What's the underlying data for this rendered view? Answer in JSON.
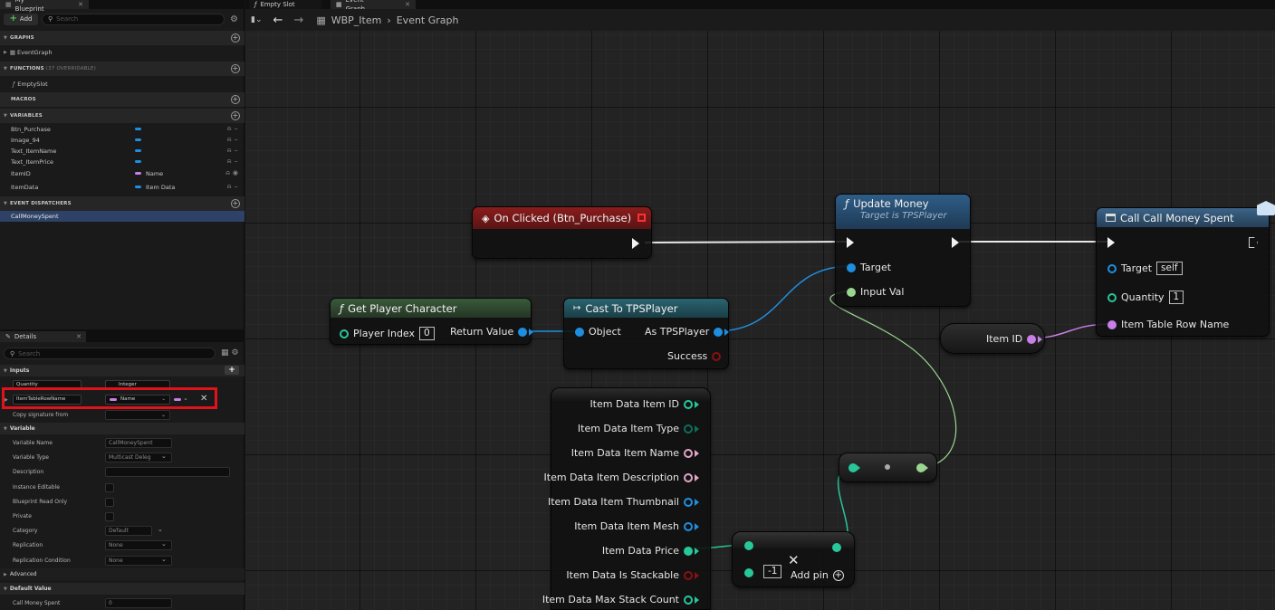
{
  "left_panel": {
    "tab_title": "My Blueprint",
    "add_label": "Add",
    "search_placeholder": "Search",
    "sections": {
      "graphs": "GRAPHS",
      "functions": "FUNCTIONS",
      "functions_sub": "(37 OVERRIDABLE)",
      "macros": "MACROS",
      "variables": "VARIABLES",
      "dispatchers": "EVENT DISPATCHERS"
    },
    "graphs": [
      "EventGraph"
    ],
    "functions": [
      "EmptySlot"
    ],
    "variables": [
      {
        "name": "Btn_Purchase",
        "type": "",
        "color": "#1e8fe0"
      },
      {
        "name": "Image_94",
        "type": "",
        "color": "#1e8fe0"
      },
      {
        "name": "Text_ItemName",
        "type": "",
        "color": "#1e8fe0"
      },
      {
        "name": "Text_ItemPrice",
        "type": "",
        "color": "#1e8fe0"
      },
      {
        "name": "ItemID",
        "type": "Name",
        "color": "#c97ee8"
      },
      {
        "name": "ItemData",
        "type": "Item Data",
        "color": "#1e8fe0"
      }
    ],
    "dispatchers": [
      "CallMoneySpent"
    ]
  },
  "details": {
    "tab_title": "Details",
    "search_placeholder": "Search",
    "inputs_label": "Inputs",
    "input_quantity_name": "Quantity",
    "input_quantity_type": "Integer",
    "input_row_name": "ItemTableRowName",
    "input_row_type": "Name",
    "copy_signature": "Copy signature from",
    "variable_label": "Variable",
    "props": [
      {
        "label": "Variable Name",
        "value": "CallMoneySpent",
        "kind": "text"
      },
      {
        "label": "Variable Type",
        "value": "Multicast Deleg",
        "kind": "text"
      },
      {
        "label": "Description",
        "value": "",
        "kind": "text"
      },
      {
        "label": "Instance Editable",
        "value": "",
        "kind": "check"
      },
      {
        "label": "Blueprint Read Only",
        "value": "",
        "kind": "check"
      },
      {
        "label": "Private",
        "value": "",
        "kind": "check"
      },
      {
        "label": "Category",
        "value": "Default",
        "kind": "text"
      },
      {
        "label": "Replication",
        "value": "None",
        "kind": "text"
      },
      {
        "label": "Replication Condition",
        "value": "None",
        "kind": "text"
      }
    ],
    "advanced_label": "Advanced",
    "default_value_label": "Default Value",
    "default_prop_label": "Call Money Spent",
    "default_prop_value": "0"
  },
  "graph": {
    "tabs": [
      "Empty Slot",
      "Event Graph"
    ],
    "breadcrumb_asset": "WBP_Item",
    "breadcrumb_graph": "Event Graph",
    "nodes": {
      "on_clicked": "On Clicked (Btn_Purchase)",
      "get_player": "Get Player Character",
      "player_index_label": "Player Index",
      "player_index_value": "0",
      "return_value": "Return Value",
      "cast": "Cast To TPSPlayer",
      "cast_object": "Object",
      "cast_as": "As TPSPlayer",
      "cast_success": "Success",
      "update_money": "Update Money",
      "update_money_sub": "Target is TPSPlayer",
      "um_target": "Target",
      "um_input": "Input Val",
      "call_money": "Call Call Money Spent",
      "cm_target": "Target",
      "cm_target_value": "self",
      "cm_quantity": "Quantity",
      "cm_quantity_value": "1",
      "cm_rowname": "Item Table Row Name",
      "item_id": "Item ID",
      "break_pins": [
        "Item Data Item ID",
        "Item Data Item Type",
        "Item Data Item Name",
        "Item Data Item Description",
        "Item Data Item Thumbnail",
        "Item Data Item Mesh",
        "Item Data Price",
        "Item Data Is Stackable",
        "Item Data Max Stack Count"
      ],
      "add_pin": "Add pin",
      "mult_value": "-1"
    }
  }
}
